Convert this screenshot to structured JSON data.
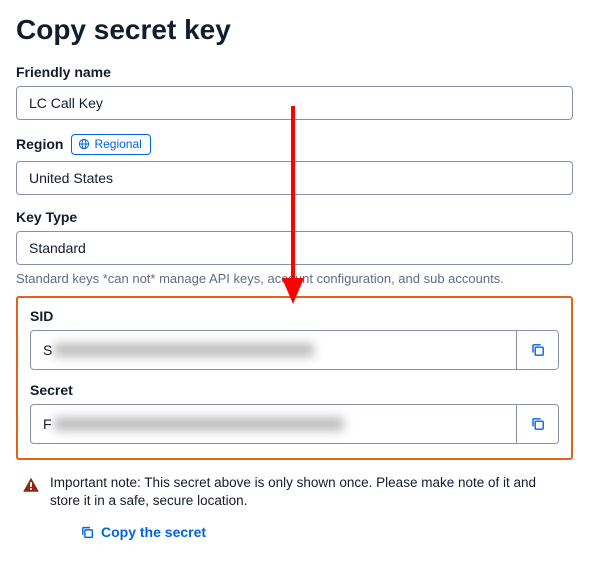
{
  "page": {
    "title": "Copy secret key"
  },
  "friendly_name": {
    "label": "Friendly name",
    "value": "LC Call Key"
  },
  "region": {
    "label": "Region",
    "badge": "Regional",
    "value": "United States"
  },
  "key_type": {
    "label": "Key Type",
    "value": "Standard",
    "helper": "Standard keys *can not* manage API keys, account configuration, and sub accounts."
  },
  "sid": {
    "label": "SID",
    "prefix": "S"
  },
  "secret": {
    "label": "Secret",
    "prefix": "F"
  },
  "note": {
    "text": "Important note: This secret above is only shown once. Please make note of it and store it in a safe, secure location."
  },
  "copy_link": {
    "label": "Copy the secret"
  },
  "colors": {
    "accent": "#0263e0",
    "highlight": "#e46216",
    "warn": "#8b2a0f"
  }
}
